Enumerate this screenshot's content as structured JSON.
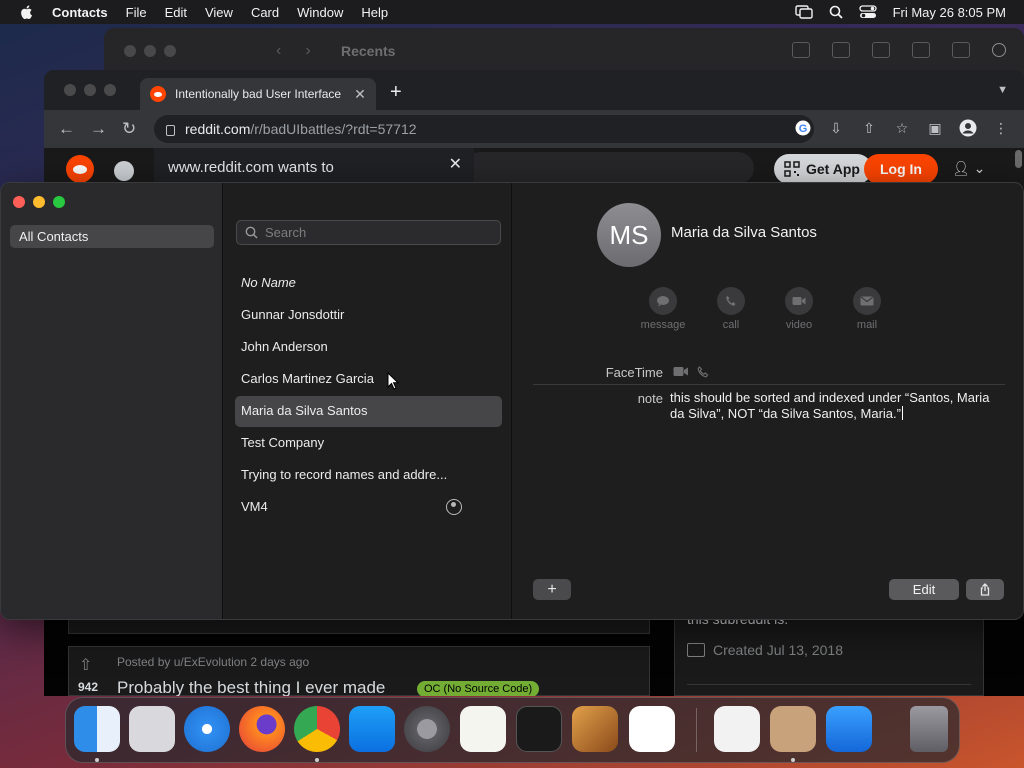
{
  "menubar": {
    "app_name": "Contacts",
    "items": [
      "File",
      "Edit",
      "View",
      "Card",
      "Window",
      "Help"
    ],
    "datetime": "Fri May 26  8:05 PM"
  },
  "bg_window": {
    "title": "Recents"
  },
  "browser": {
    "tab_title": "Intentionally bad User Interface",
    "url_host": "reddit.com",
    "url_path": "/r/badUIbattles/?rdt=57712",
    "permission_prompt": "www.reddit.com wants to",
    "header": {
      "get_app": "Get App",
      "log_in": "Log In"
    },
    "post": {
      "posted_by": "Posted by u/ExEvolution 2 days ago",
      "votes": "942",
      "title": "Probably the best thing I ever made",
      "flair": "OC (No Source Code)"
    },
    "sidebar": {
      "about_tail": "this subreddit is.",
      "created": "Created Jul 13, 2018"
    }
  },
  "contacts_app": {
    "groups": [
      "All Contacts"
    ],
    "search_placeholder": "Search",
    "list": [
      {
        "name": "No Name",
        "italic": true
      },
      {
        "name": "Gunnar Jonsdottir"
      },
      {
        "name": "John Anderson"
      },
      {
        "name": "Carlos Martinez Garcia"
      },
      {
        "name": "Maria da Silva Santos",
        "selected": true
      },
      {
        "name": "Test Company"
      },
      {
        "name": "Trying to record names and addre..."
      },
      {
        "name": "VM4",
        "me_card": true
      }
    ],
    "detail": {
      "initials": "MS",
      "full_name": "Maria da Silva Santos",
      "actions": [
        "message",
        "call",
        "video",
        "mail"
      ],
      "facetime_label": "FaceTime",
      "note_label": "note",
      "note_text": "this should be sorted and indexed under “Santos, Maria da Silva”, NOT “da Silva Santos, Maria.”",
      "add_label": "+",
      "edit_label": "Edit"
    }
  },
  "dock": {
    "apps": [
      "Finder",
      "Launchpad",
      "Safari",
      "Firefox",
      "Chrome",
      "App Store",
      "System Settings",
      "TextEdit",
      "Terminal",
      "Instruments",
      "Visual Studio Code",
      "Visual Studio",
      "Contacts",
      "Mail",
      "Trash"
    ]
  },
  "colors": {
    "reddit_orange": "#ff4500",
    "selection_gray": "#464649",
    "flair_green": "#73ad34"
  }
}
